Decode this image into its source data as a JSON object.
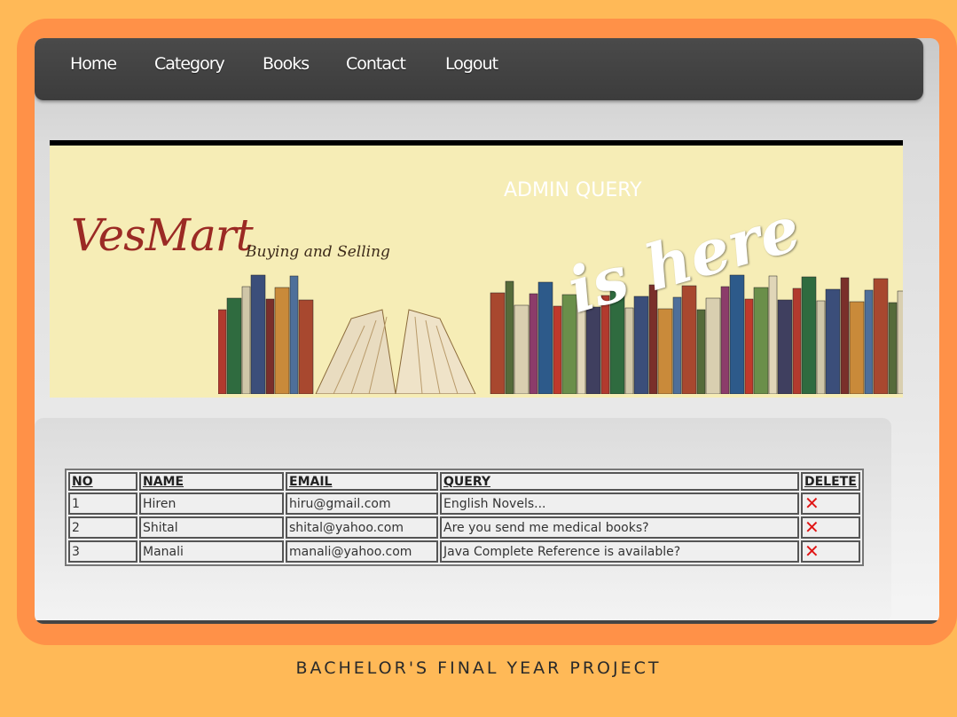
{
  "nav": {
    "items": [
      "Home",
      "Category",
      "Books",
      "Contact",
      "Logout"
    ]
  },
  "banner": {
    "heading": "ADMIN QUERY",
    "logo": "VesMart",
    "tagline": "Buying and Selling",
    "overlay": "is here"
  },
  "table": {
    "headers": [
      "NO",
      "NAME",
      "EMAIL",
      "QUERY",
      "DELETE"
    ],
    "rows": [
      {
        "no": "1",
        "name": "Hiren",
        "email": "hiru@gmail.com",
        "query": "English Novels..."
      },
      {
        "no": "2",
        "name": "Shital",
        "email": "shital@yahoo.com",
        "query": "Are you send me medical books?"
      },
      {
        "no": "3",
        "name": "Manali",
        "email": "manali@yahoo.com",
        "query": "Java Complete Reference is available?"
      }
    ],
    "delete_icon": "close-x-icon",
    "delete_color": "#e01515"
  },
  "caption": "BACHELOR'S FINAL YEAR PROJECT",
  "colors": {
    "background": "#FFB957",
    "frame": "#FF9148",
    "navbar": "#444444",
    "banner": "#f6edb6",
    "logo": "#9b2a24"
  }
}
